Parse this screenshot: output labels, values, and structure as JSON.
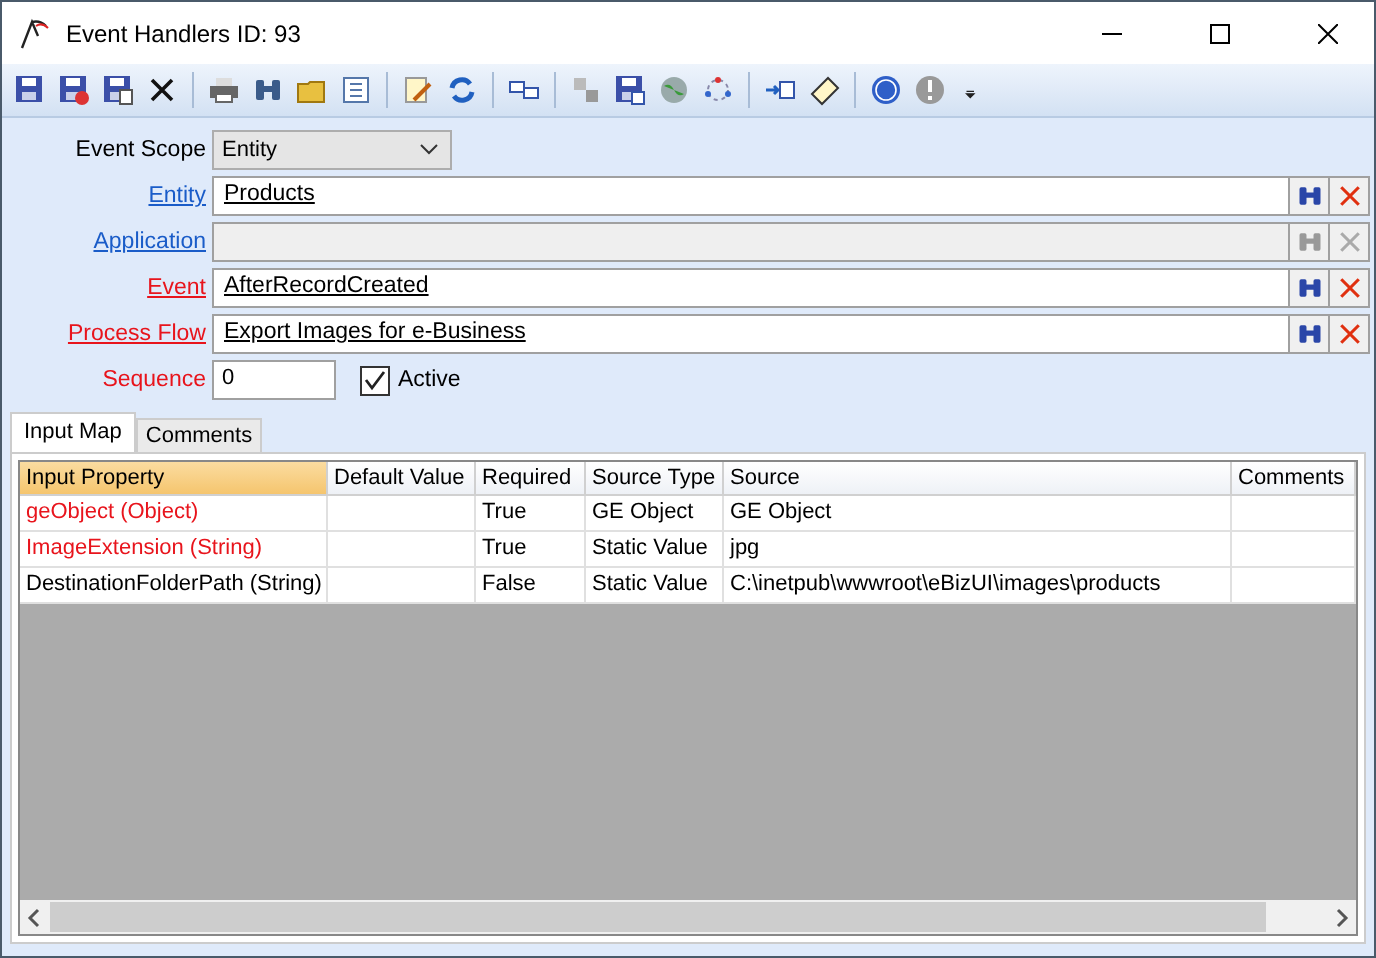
{
  "window": {
    "title": "Event Handlers ID: 93"
  },
  "form": {
    "fields": [
      {
        "label": {
          "text": "Event Scope",
          "kind": "plain"
        },
        "kind": "select",
        "value": "Entity"
      },
      {
        "label": {
          "text": "Entity",
          "kind": "link"
        },
        "kind": "lookup",
        "value": "Products",
        "disabled": false
      },
      {
        "label": {
          "text": "Application",
          "kind": "link"
        },
        "kind": "lookup",
        "disabled": true
      },
      {
        "label": {
          "text": "Event",
          "kind": "required-link"
        },
        "kind": "lookup",
        "value": "AfterRecordCreated",
        "disabled": false
      },
      {
        "label": {
          "text": "Process Flow",
          "kind": "required-link"
        },
        "kind": "lookup",
        "value": "Export Images for e-Business",
        "disabled": false
      },
      {
        "label": {
          "text": "Sequence",
          "kind": "required"
        },
        "kind": "number",
        "value": "0",
        "checkbox": {
          "label": "Active",
          "checked": true
        }
      }
    ]
  },
  "tabs": [
    {
      "label": "Input Map",
      "selected": true
    },
    {
      "label": "Comments",
      "selected": false
    }
  ],
  "table": {
    "columns": [
      "Input Property",
      "Default Value",
      "Required",
      "Source Type",
      "Source",
      "Comments"
    ],
    "rows": [
      {
        "cells": [
          "geObject (Object)",
          "",
          "True",
          "GE Object",
          "GE Object",
          ""
        ],
        "flagged": true
      },
      {
        "cells": [
          "ImageExtension (String)",
          "",
          "True",
          "Static Value",
          "jpg",
          ""
        ],
        "flagged": true
      },
      {
        "cells": [
          "DestinationFolderPath (String)",
          "",
          "False",
          "Static Value",
          "C:\\inetpub\\wwwroot\\eBizUI\\images\\products",
          ""
        ],
        "flagged": false
      }
    ]
  }
}
